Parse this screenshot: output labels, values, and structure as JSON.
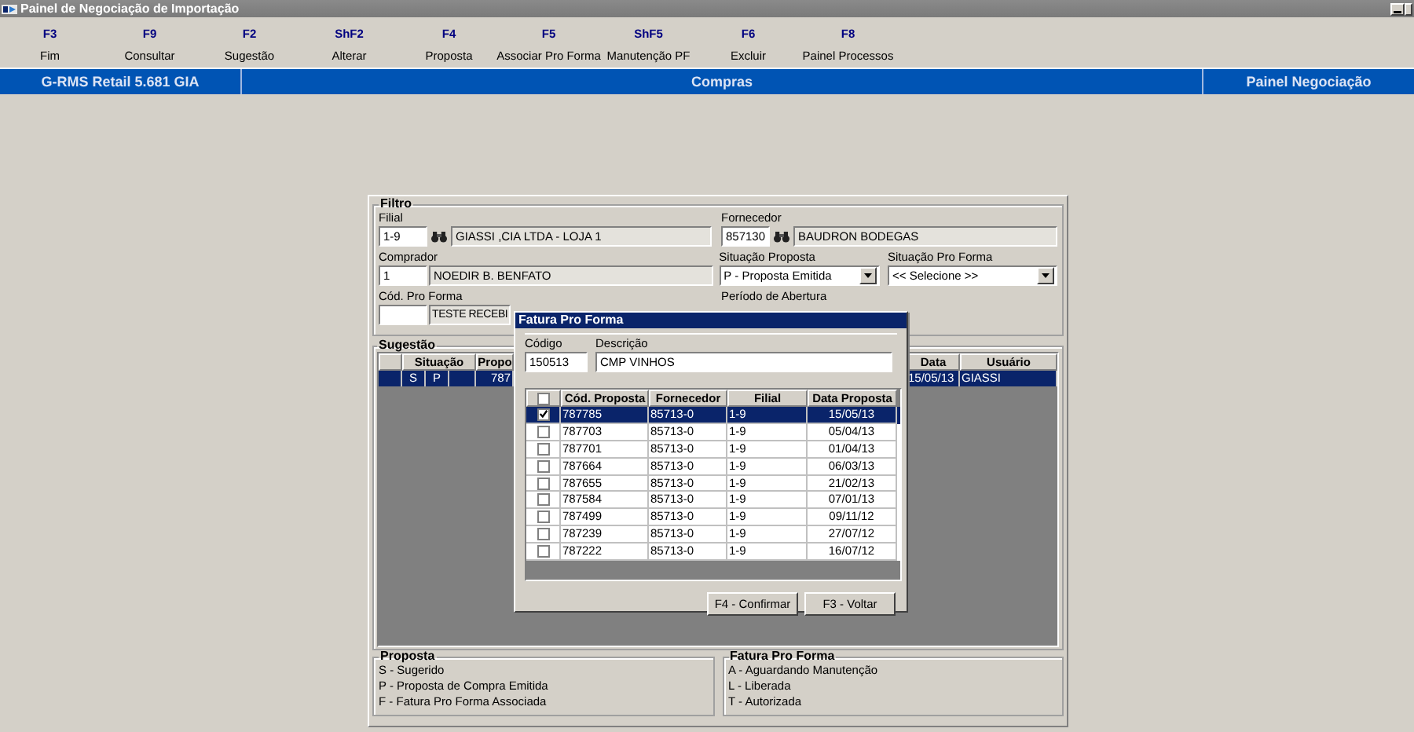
{
  "window": {
    "title": "Painel de Negociação de Importação"
  },
  "toolbar": [
    {
      "key": "F3",
      "label": "Fim"
    },
    {
      "key": "F9",
      "label": "Consultar"
    },
    {
      "key": "F2",
      "label": "Sugestão"
    },
    {
      "key": "ShF2",
      "label": "Alterar"
    },
    {
      "key": "F4",
      "label": "Proposta"
    },
    {
      "key": "F5",
      "label": "Associar Pro Forma"
    },
    {
      "key": "ShF5",
      "label": "Manutenção PF"
    },
    {
      "key": "F6",
      "label": "Excluir"
    },
    {
      "key": "F8",
      "label": "Painel Processos"
    }
  ],
  "banner": [
    "G-RMS Retail 5.681 GIA",
    "Compras",
    "Painel Negociação"
  ],
  "filter": {
    "title": "Filtro",
    "filial": {
      "label": "Filial",
      "code": "1-9",
      "name": "GIASSI ,CIA LTDA - LOJA 1"
    },
    "fornecedor": {
      "label": "Fornecedor",
      "code": "857130",
      "name": "BAUDRON BODEGAS"
    },
    "comprador": {
      "label": "Comprador",
      "code": "1",
      "name": "NOEDIR B. BENFATO"
    },
    "situacao_proposta": {
      "label": "Situação Proposta",
      "value": "P - Proposta Emitida"
    },
    "situacao_pro_forma": {
      "label": "Situação Pro Forma",
      "value": "<< Selecione >>"
    },
    "cod_pro_forma": {
      "label": "Cód. Pro Forma",
      "name": "TESTE RECEBI"
    },
    "periodo": {
      "label": "Período de Abertura"
    }
  },
  "sugestao": {
    "title": "Sugestão",
    "columns": [
      "Situação",
      "Propo",
      "Data",
      "Usuário"
    ],
    "rows": [
      {
        "selected": true,
        "situacao": [
          "S",
          "P"
        ],
        "proposta": "787",
        "data": "15/05/13",
        "usuario": "GIASSI"
      }
    ]
  },
  "dialog": {
    "title": "Fatura Pro Forma",
    "codigo": {
      "label": "Código",
      "value": "150513"
    },
    "descricao": {
      "label": "Descrição",
      "value": "CMP VINHOS"
    },
    "columns": [
      "Cód. Proposta",
      "Fornecedor",
      "Filial",
      "Data Proposta"
    ],
    "rows": [
      {
        "selected": true,
        "checked": true,
        "cells": [
          "787785",
          "85713-0",
          "1-9",
          "15/05/13"
        ]
      },
      {
        "selected": false,
        "checked": false,
        "cells": [
          "787703",
          "85713-0",
          "1-9",
          "05/04/13"
        ]
      },
      {
        "selected": false,
        "checked": false,
        "cells": [
          "787701",
          "85713-0",
          "1-9",
          "01/04/13"
        ]
      },
      {
        "selected": false,
        "checked": false,
        "cells": [
          "787664",
          "85713-0",
          "1-9",
          "06/03/13"
        ]
      },
      {
        "selected": false,
        "checked": false,
        "cells": [
          "787655",
          "85713-0",
          "1-9",
          "21/02/13"
        ]
      },
      {
        "selected": false,
        "checked": false,
        "cells": [
          "787584",
          "85713-0",
          "1-9",
          "07/01/13"
        ]
      },
      {
        "selected": false,
        "checked": false,
        "cells": [
          "787499",
          "85713-0",
          "1-9",
          "09/11/12"
        ]
      },
      {
        "selected": false,
        "checked": false,
        "cells": [
          "787239",
          "85713-0",
          "1-9",
          "27/07/12"
        ]
      },
      {
        "selected": false,
        "checked": false,
        "cells": [
          "787222",
          "85713-0",
          "1-9",
          "16/07/12"
        ]
      }
    ],
    "buttons": [
      "F4 - Confirmar",
      "F3 - Voltar"
    ]
  },
  "legends": [
    {
      "title": "Proposta",
      "items": [
        "S - Sugerido",
        "P - Proposta de Compra Emitida",
        "F - Fatura Pro Forma Associada"
      ]
    },
    {
      "title": "Fatura Pro Forma",
      "items": [
        "A - Aguardando Manutenção",
        "L - Liberada",
        "T - Autorizada"
      ]
    }
  ]
}
